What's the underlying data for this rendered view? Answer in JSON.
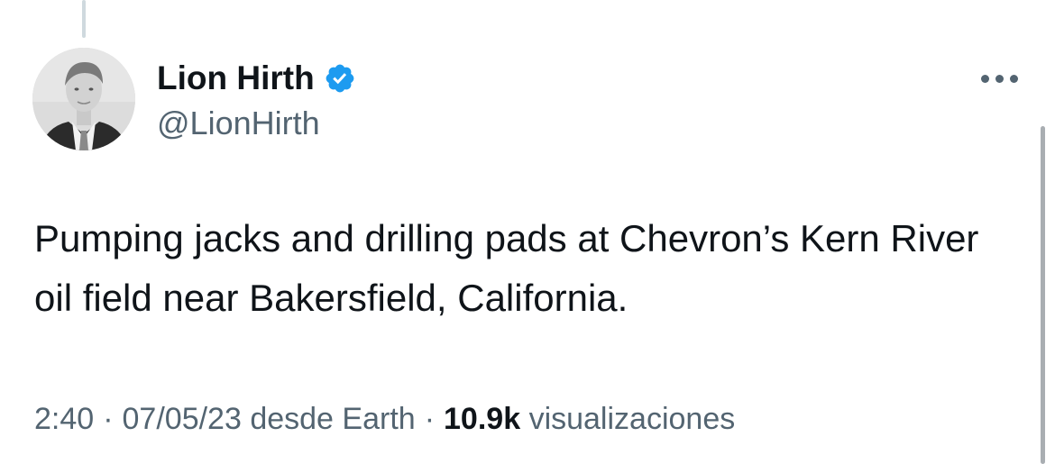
{
  "author": {
    "display_name": "Lion Hirth",
    "handle": "@LionHirth",
    "verified_icon": "verified-badge-icon",
    "avatar_icon": "profile-photo"
  },
  "menu": {
    "icon": "more-options-icon"
  },
  "tweet": {
    "text": "Pumping jacks and drilling pads at Chevron’s Kern River oil field near Bakersfield, California."
  },
  "meta": {
    "time": "2:40",
    "separator": "·",
    "date": "07/05/23",
    "source": "desde Earth",
    "views_count": "10.9k",
    "views_label": "visualizaciones"
  },
  "colors": {
    "verified": "#1d9bf0",
    "text_primary": "#0f1419",
    "text_secondary": "#536471",
    "thread_line": "#cfd9de"
  }
}
